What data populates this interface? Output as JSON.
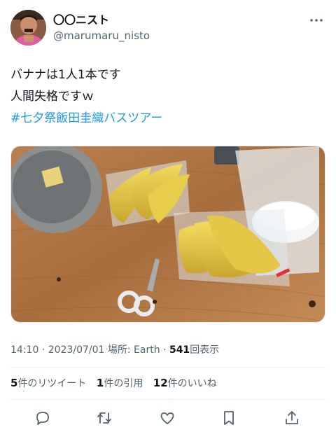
{
  "user": {
    "display_name": "〇〇ニスト",
    "handle": "@marumaru_nisto"
  },
  "tweet": {
    "lines": [
      "バナナは1人1本です",
      "人間失格ですｗ"
    ],
    "hashtag": "#七夕祭飯田圭織バスツアー"
  },
  "meta": {
    "time": "14:10",
    "separator": " · ",
    "date": "2023/07/01",
    "location_prefix": " 場所: ",
    "location": "Earth",
    "views": "541",
    "views_label": "回表示"
  },
  "stats": {
    "retweets": "5",
    "retweets_label": "件のリツイート",
    "quotes": "1",
    "quotes_label": "件の引用",
    "likes": "12",
    "likes_label": "件のいいね"
  },
  "icons": {
    "more": "more-horizontal-icon",
    "reply": "reply-icon",
    "retweet": "retweet-icon",
    "like": "heart-icon",
    "bookmark": "bookmark-icon",
    "share": "share-icon"
  },
  "colors": {
    "hashtag": "#1d9bf0",
    "secondary_text": "#536471",
    "primary_text": "#0f1419"
  }
}
